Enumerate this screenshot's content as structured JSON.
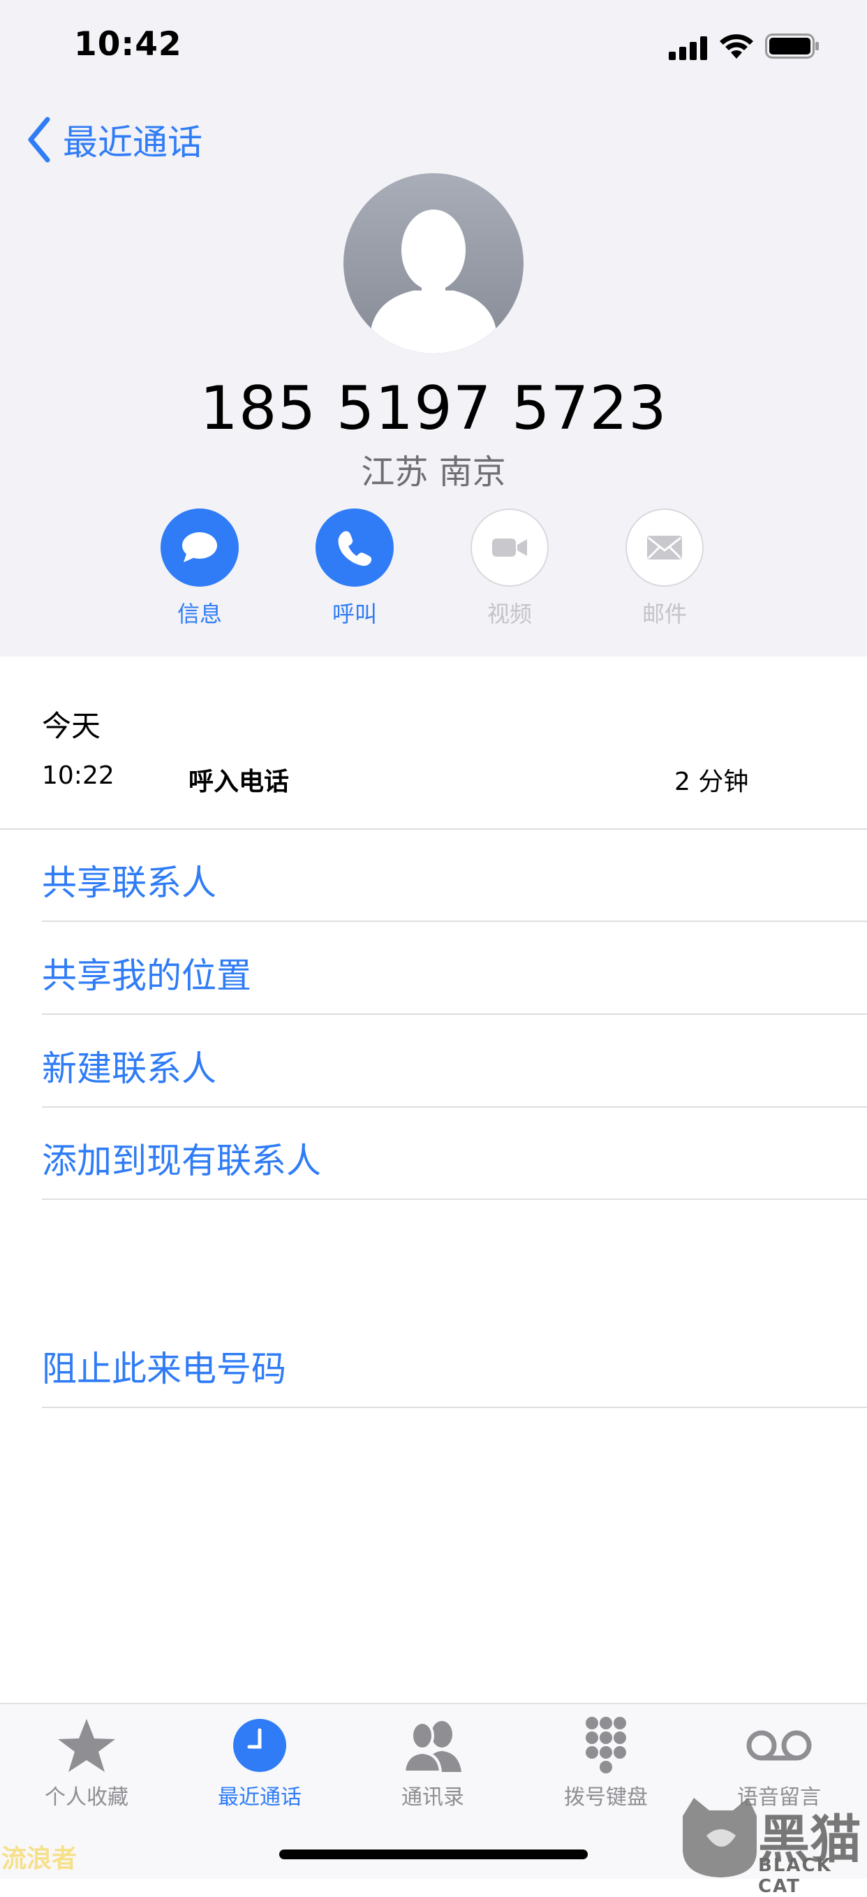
{
  "status_bar": {
    "time": "10:42"
  },
  "nav": {
    "back_label": "最近通话"
  },
  "contact": {
    "number": "185 5197 5723",
    "location": "江苏 南京"
  },
  "actions": [
    {
      "label": "信息",
      "icon": "message-bubble-icon",
      "enabled": true
    },
    {
      "label": "呼叫",
      "icon": "phone-icon",
      "enabled": true
    },
    {
      "label": "视频",
      "icon": "video-camera-icon",
      "enabled": false
    },
    {
      "label": "邮件",
      "icon": "mail-icon",
      "enabled": false
    }
  ],
  "call_log": {
    "day": "今天",
    "entries": [
      {
        "time": "10:22",
        "type": "呼入电话",
        "duration": "2 分钟"
      }
    ]
  },
  "options": [
    "共享联系人",
    "共享我的位置",
    "新建联系人",
    "添加到现有联系人"
  ],
  "block_option": "阻止此来电号码",
  "tabs": [
    {
      "label": "个人收藏",
      "icon": "star-icon",
      "active": false
    },
    {
      "label": "最近通话",
      "icon": "clock-icon",
      "active": true
    },
    {
      "label": "通讯录",
      "icon": "contacts-icon",
      "active": false
    },
    {
      "label": "拨号键盘",
      "icon": "keypad-icon",
      "active": false
    },
    {
      "label": "语音留言",
      "icon": "voicemail-icon",
      "active": false
    }
  ],
  "colors": {
    "accent": "#2f7cf6",
    "header_bg": "#f2f2f7",
    "disabled": "#c3c3c8",
    "inactive_tab": "#8e8e93"
  },
  "watermarks": {
    "left": "流浪者",
    "brand": "黑猫",
    "brand_sub": "BLACK CAT"
  }
}
